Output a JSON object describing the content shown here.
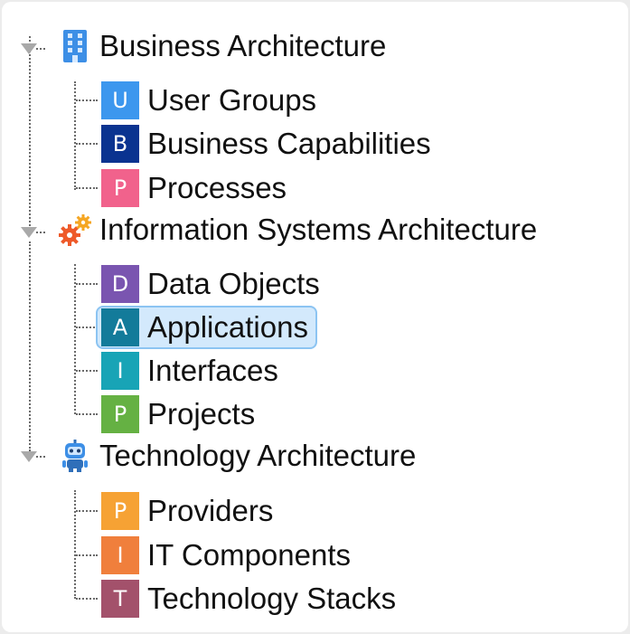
{
  "tree": {
    "groups": [
      {
        "label": "Business Architecture",
        "icon": "building-icon",
        "items": [
          {
            "badge": "U",
            "label": "User Groups",
            "color": "#3c97ee"
          },
          {
            "badge": "B",
            "label": "Business Capabilities",
            "color": "#0a3390"
          },
          {
            "badge": "P",
            "label": "Processes",
            "color": "#f1628c"
          }
        ]
      },
      {
        "label": "Information Systems Architecture",
        "icon": "gears-icon",
        "items": [
          {
            "badge": "D",
            "label": "Data Objects",
            "color": "#7a55b0"
          },
          {
            "badge": "A",
            "label": "Applications",
            "color": "#137b9a",
            "selected": true
          },
          {
            "badge": "I",
            "label": "Interfaces",
            "color": "#18a4b6"
          },
          {
            "badge": "P",
            "label": "Projects",
            "color": "#65b143"
          }
        ]
      },
      {
        "label": "Technology Architecture",
        "icon": "robot-icon",
        "items": [
          {
            "badge": "P",
            "label": "Providers",
            "color": "#f6a234"
          },
          {
            "badge": "I",
            "label": "IT Components",
            "color": "#f07f3c"
          },
          {
            "badge": "T",
            "label": "Technology Stacks",
            "color": "#a3516b"
          }
        ]
      }
    ]
  }
}
